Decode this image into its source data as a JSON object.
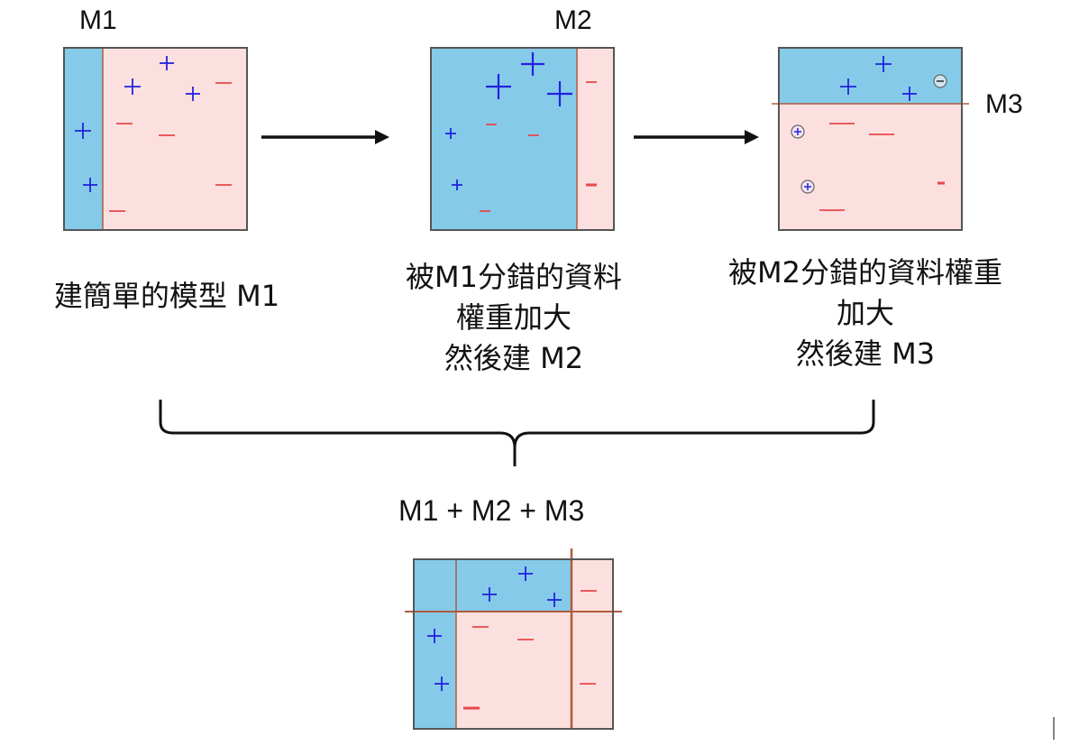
{
  "model_labels": {
    "m1": "M1",
    "m2": "M2",
    "m3": "M3"
  },
  "captions": {
    "m1": [
      "建簡單的模型 M1"
    ],
    "m2": [
      "被M1分錯的資料",
      "權重加大",
      "然後建 M2"
    ],
    "m3": [
      "被M2分錯的資料權重",
      "加大",
      "然後建 M3"
    ]
  },
  "combined_label": "M1 + M2 + M3",
  "colors": {
    "positive_region": "#85cbe9",
    "negative_region": "#fce0e0",
    "plus_sign": "#2222dd",
    "minus_sign": "#e8484a",
    "boundary": "#b25a3c",
    "frame": "#555555"
  },
  "symbols": {
    "positive": "+",
    "negative": "−"
  }
}
